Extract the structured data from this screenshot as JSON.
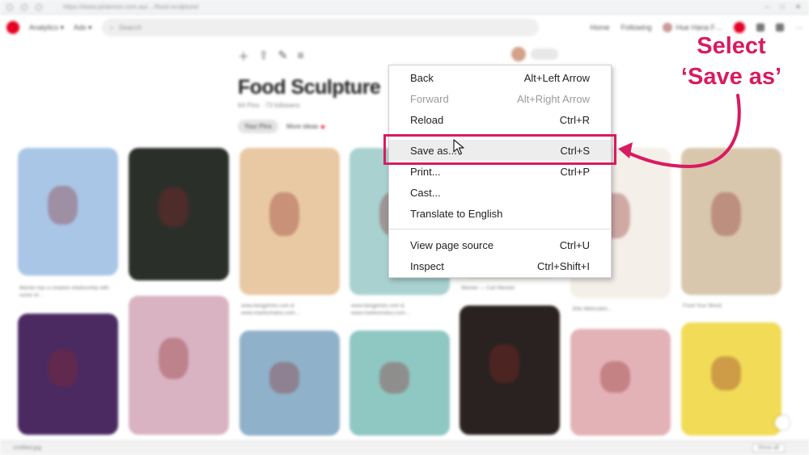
{
  "browser": {
    "url": "https://www.pinterest.com.au/…/food-sculpture/",
    "window_controls": [
      "–",
      "□",
      "✕"
    ]
  },
  "app_header": {
    "menu_a": "Analytics ▾",
    "menu_b": "Ads ▾",
    "search_placeholder": "Search",
    "home": "Home",
    "following": "Following",
    "user": "Hue Hana F…",
    "more": "···"
  },
  "board": {
    "tools": [
      "＋",
      "⇪",
      "✎",
      "≡"
    ],
    "title": "Food Sculpture",
    "meta": "64 Pins · 73 followers",
    "tab_your_pins": "Your Pins",
    "tab_more_ideas": "More ideas"
  },
  "pins": [
    {
      "color": "#a9c6e6",
      "caption": "Marian has a creative relationship with some of…"
    },
    {
      "color": "#2b2f2a",
      "caption": ""
    },
    {
      "color": "#e9c9a3",
      "caption": "www.liangphoto.com & www.marikomatsu.com…"
    },
    {
      "color": "#a8d1cf",
      "caption": "www.liangphoto.com & www.marikomatsu.com…"
    },
    {
      "color": "#e6c35a",
      "caption": "Meister — Carl Meister"
    },
    {
      "color": "#f4efe9",
      "caption": "Ellis Mehrzahn…"
    },
    {
      "color": "#d8c7ad",
      "caption": "Food Your Mood"
    },
    {
      "color": "#4b2a62",
      "caption": ""
    },
    {
      "color": "#d9b3c2",
      "caption": ""
    },
    {
      "color": "#8fb1c9",
      "caption": ""
    },
    {
      "color": "#8fc7c2",
      "caption": ""
    },
    {
      "color": "#2a2220",
      "caption": ""
    },
    {
      "color": "#e3b2b7",
      "caption": ""
    },
    {
      "color": "#f1db57",
      "caption": ""
    }
  ],
  "context_menu": {
    "items": [
      {
        "label": "Back",
        "shortcut": "Alt+Left Arrow",
        "disabled": false
      },
      {
        "label": "Forward",
        "shortcut": "Alt+Right Arrow",
        "disabled": true
      },
      {
        "label": "Reload",
        "shortcut": "Ctrl+R",
        "disabled": false
      },
      {
        "label": "Save as...",
        "shortcut": "Ctrl+S",
        "disabled": false
      },
      {
        "label": "Print...",
        "shortcut": "Ctrl+P",
        "disabled": false
      },
      {
        "label": "Cast...",
        "shortcut": "",
        "disabled": false
      },
      {
        "label": "Translate to English",
        "shortcut": "",
        "disabled": false
      },
      {
        "label": "View page source",
        "shortcut": "Ctrl+U",
        "disabled": false
      },
      {
        "label": "Inspect",
        "shortcut": "Ctrl+Shift+I",
        "disabled": false
      }
    ]
  },
  "annotation": {
    "line1": "Select",
    "line2": "‘Save as’",
    "color": "#d81b60"
  },
  "status_bar": {
    "download": "Untitled.jpg",
    "show_all": "Show all"
  }
}
